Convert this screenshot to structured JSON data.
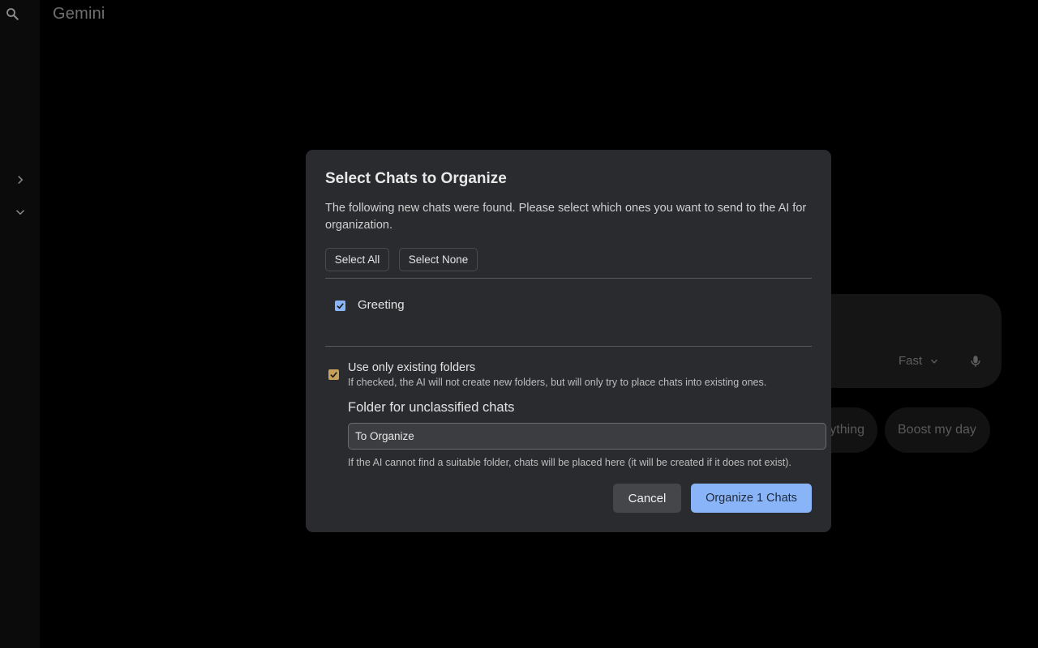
{
  "app": {
    "title": "Gemini"
  },
  "background": {
    "mode_label": "Fast",
    "chips": [
      "ything",
      "Boost my day"
    ]
  },
  "dialog": {
    "title": "Select Chats to Organize",
    "description": "The following new chats were found. Please select which ones you want to send to the AI for organization.",
    "select_all_label": "Select All",
    "select_none_label": "Select None",
    "chats": [
      {
        "label": "Greeting",
        "checked": true
      }
    ],
    "existing_folders": {
      "label": "Use only existing folders",
      "help": "If checked, the AI will not create new folders, but will only try to place chats into existing ones.",
      "checked": true
    },
    "folder": {
      "heading": "Folder for unclassified chats",
      "value": "To Organize",
      "help": "If the AI cannot find a suitable folder, chats will be placed here (it will be created if it does not exist)."
    },
    "cancel_label": "Cancel",
    "organize_label": "Organize 1 Chats"
  },
  "colors": {
    "accent": "#8ab4f8",
    "dialog_bg": "#2a2b2e",
    "checkbox_alt": "#c7a15a"
  }
}
